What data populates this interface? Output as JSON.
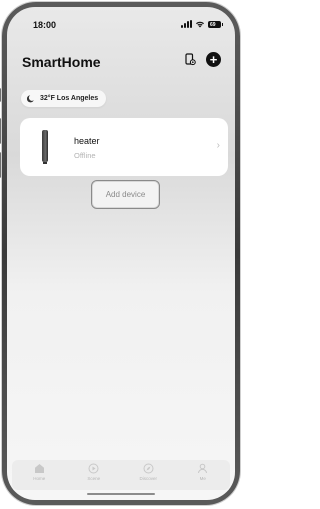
{
  "status_bar": {
    "time": "18:00",
    "battery": "69"
  },
  "header": {
    "title": "SmartHome"
  },
  "weather": {
    "text": "32°F Los Angeles"
  },
  "device": {
    "name": "heater",
    "status": "Offline"
  },
  "add_device": {
    "label": "Add device"
  },
  "tabs": [
    {
      "label": "Home",
      "icon": "home-icon"
    },
    {
      "label": "Scene",
      "icon": "scene-icon"
    },
    {
      "label": "Discover",
      "icon": "discover-icon"
    },
    {
      "label": "Me",
      "icon": "person-icon"
    }
  ]
}
